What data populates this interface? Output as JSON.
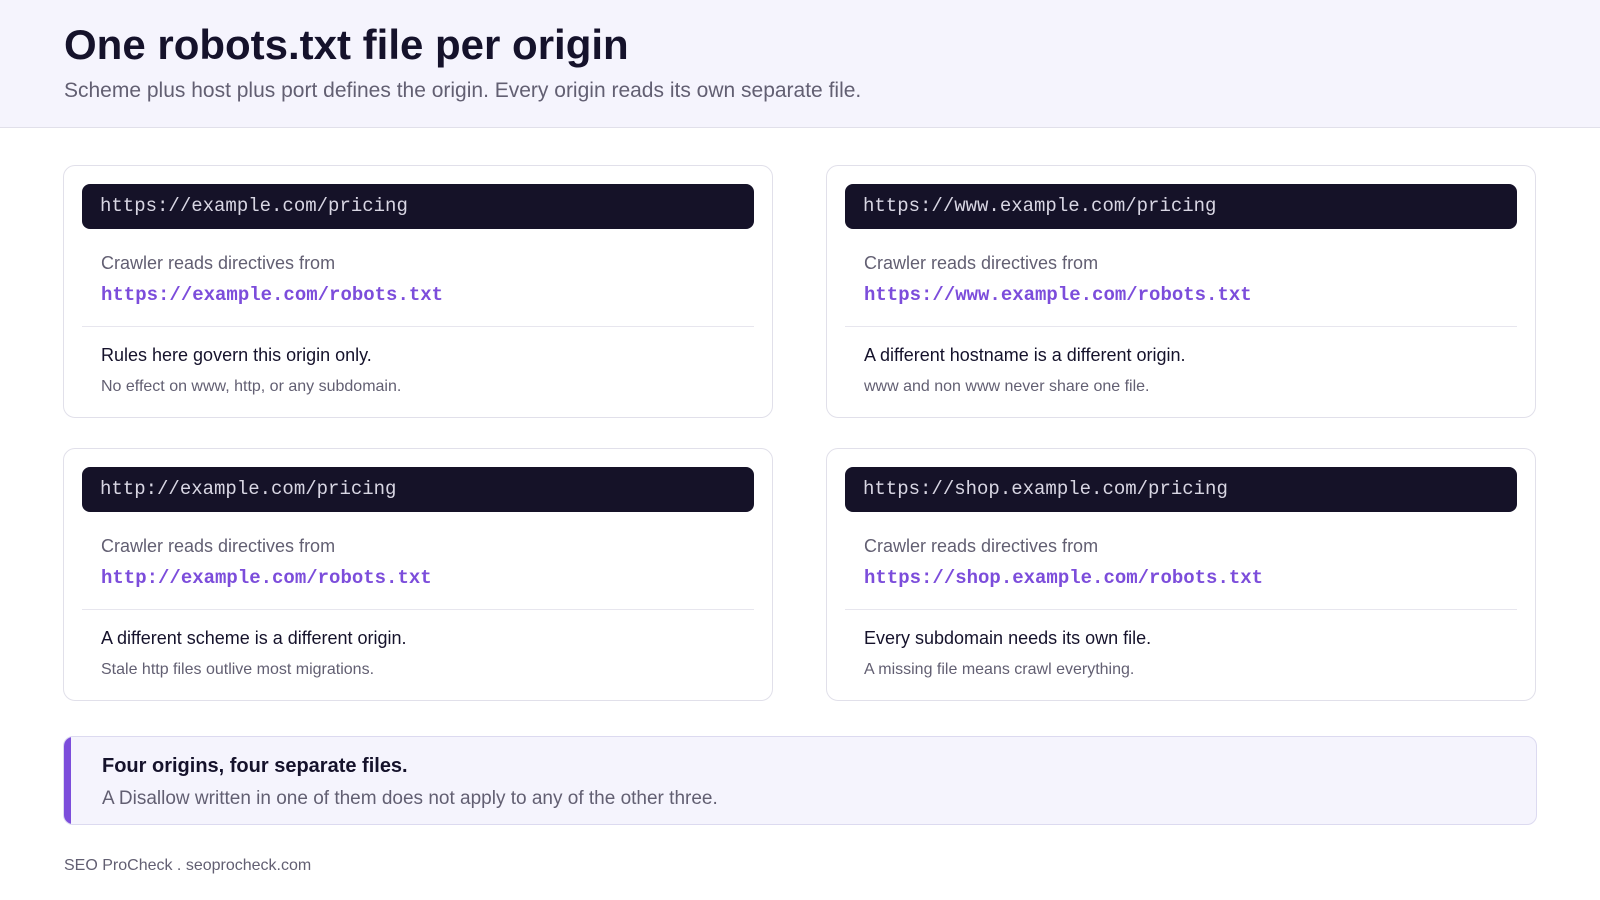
{
  "header": {
    "title": "One robots.txt file per origin",
    "subtitle": "Scheme plus host plus port defines the origin. Every origin reads its own separate file."
  },
  "cards": [
    {
      "page_url": "https://example.com/pricing",
      "reads_label": "Crawler reads directives from",
      "robots_url": "https://example.com/robots.txt",
      "rule_main": "Rules here govern this origin only.",
      "rule_sub": "No effect on www, http, or any subdomain."
    },
    {
      "page_url": "https://www.example.com/pricing",
      "reads_label": "Crawler reads directives from",
      "robots_url": "https://www.example.com/robots.txt",
      "rule_main": "A different hostname is a different origin.",
      "rule_sub": "www and non www never share one file."
    },
    {
      "page_url": "http://example.com/pricing",
      "reads_label": "Crawler reads directives from",
      "robots_url": "http://example.com/robots.txt",
      "rule_main": "A different scheme is a different origin.",
      "rule_sub": "Stale http files outlive most migrations."
    },
    {
      "page_url": "https://shop.example.com/pricing",
      "reads_label": "Crawler reads directives from",
      "robots_url": "https://shop.example.com/robots.txt",
      "rule_main": "Every subdomain needs its own file.",
      "rule_sub": "A missing file means crawl everything."
    }
  ],
  "callout": {
    "title": "Four origins, four separate files.",
    "text": "A Disallow written in one of them does not apply to any of the other three."
  },
  "footer": {
    "text": "SEO ProCheck . seoprocheck.com"
  },
  "colors": {
    "accent": "#7c4ddb",
    "dark": "#151228",
    "header_bg": "#f5f4fd"
  }
}
